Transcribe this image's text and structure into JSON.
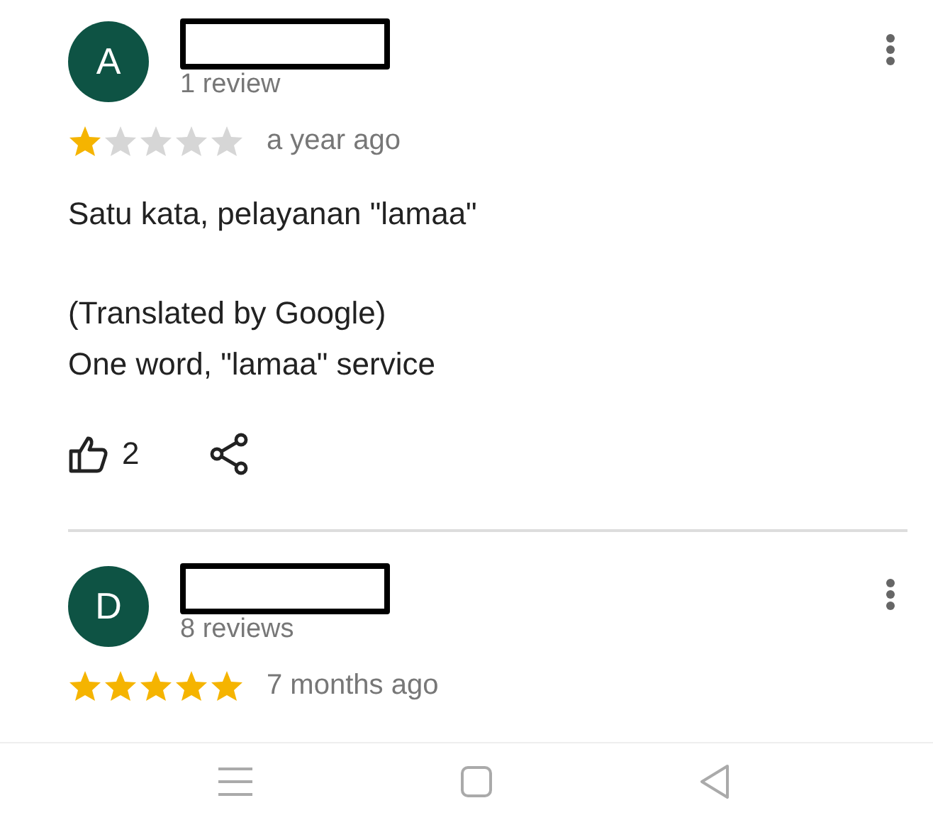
{
  "reviews": [
    {
      "avatar": "A",
      "review_count": "1 review",
      "stars": 1,
      "time": "a year ago",
      "text": "Satu kata, pelayanan \"lamaa\"",
      "translated_label": "(Translated by Google)",
      "translation": "One word, \"lamaa\" service",
      "likes": "2"
    },
    {
      "avatar": "D",
      "review_count": "8 reviews",
      "stars": 5,
      "time": "7 months ago"
    }
  ]
}
